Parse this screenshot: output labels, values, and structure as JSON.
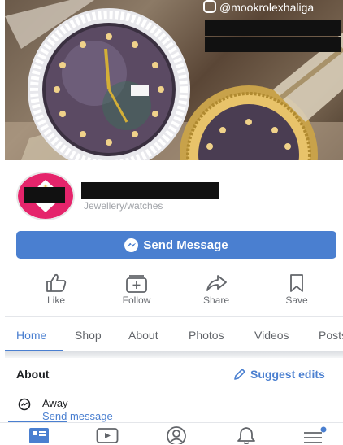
{
  "cover": {
    "handle": "@mookrolexhaliga"
  },
  "page": {
    "category": "Jewellery/watches"
  },
  "primary_action": {
    "label": "Send Message"
  },
  "actions": [
    {
      "label": "Like",
      "icon": "thumbs-up-icon"
    },
    {
      "label": "Follow",
      "icon": "follow-icon"
    },
    {
      "label": "Share",
      "icon": "share-icon"
    },
    {
      "label": "Save",
      "icon": "bookmark-icon"
    }
  ],
  "tabs": [
    {
      "label": "Home",
      "active": true
    },
    {
      "label": "Shop"
    },
    {
      "label": "About"
    },
    {
      "label": "Photos"
    },
    {
      "label": "Videos"
    },
    {
      "label": "Posts"
    }
  ],
  "about": {
    "title": "About",
    "suggest_label": "Suggest edits",
    "status": "Away",
    "send_message_link": "Send message"
  },
  "bottom_nav": [
    {
      "icon": "news-feed-icon",
      "active": true
    },
    {
      "icon": "watch-video-icon"
    },
    {
      "icon": "profile-icon"
    },
    {
      "icon": "notifications-bell-icon"
    },
    {
      "icon": "menu-icon",
      "badge": true
    }
  ],
  "colors": {
    "accent": "#4a7fd0",
    "logo_pink": "#e5246b"
  }
}
